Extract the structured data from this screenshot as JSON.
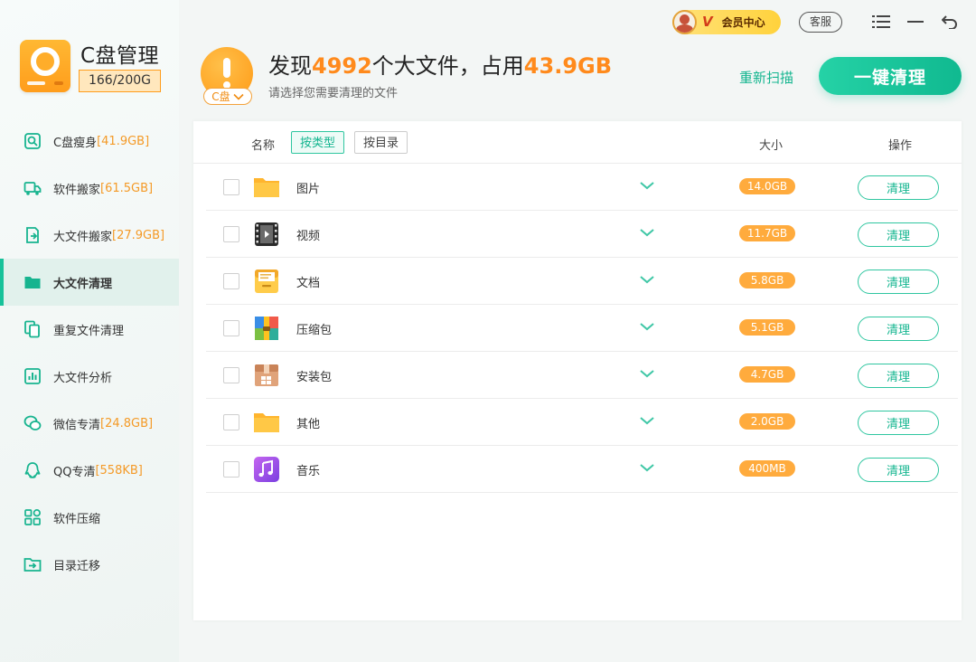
{
  "app": {
    "title": "C盘管理",
    "usage": "166/200G"
  },
  "topbar": {
    "vip_mark": "V",
    "vip_label": "会员中心",
    "service_label": "客服"
  },
  "sidebar": {
    "items": [
      {
        "label": "C盘瘦身",
        "size": "[41.9GB]",
        "icon": "disk-slim-icon"
      },
      {
        "label": "软件搬家",
        "size": "[61.5GB]",
        "icon": "truck-icon"
      },
      {
        "label": "大文件搬家",
        "size": "[27.9GB]",
        "icon": "file-move-icon"
      },
      {
        "label": "大文件清理",
        "size": "",
        "icon": "folder-icon",
        "active": true
      },
      {
        "label": "重复文件清理",
        "size": "",
        "icon": "duplicate-icon"
      },
      {
        "label": "大文件分析",
        "size": "",
        "icon": "chart-icon"
      },
      {
        "label": "微信专清",
        "size": "[24.8GB]",
        "icon": "wechat-icon"
      },
      {
        "label": "QQ专清",
        "size": "[558KB]",
        "icon": "qq-icon"
      },
      {
        "label": "软件压缩",
        "size": "",
        "icon": "grid-icon"
      },
      {
        "label": "目录迁移",
        "size": "",
        "icon": "folder-arrow-icon"
      }
    ]
  },
  "header": {
    "drive_label": "C盘",
    "prefix": "发现",
    "count": "4992",
    "middle": "个大文件，占用",
    "total": "43.9GB",
    "subtitle": "请选择您需要清理的文件",
    "rescan_label": "重新扫描",
    "clean_all_label": "一键清理"
  },
  "table": {
    "col_name": "名称",
    "filter_type": "按类型",
    "filter_dir": "按目录",
    "col_size": "大小",
    "col_action": "操作",
    "row_action_label": "清理",
    "rows": [
      {
        "name": "图片",
        "size": "14.0GB",
        "icon": "picture-folder-icon"
      },
      {
        "name": "视频",
        "size": "11.7GB",
        "icon": "video-icon"
      },
      {
        "name": "文档",
        "size": "5.8GB",
        "icon": "document-icon"
      },
      {
        "name": "压缩包",
        "size": "5.1GB",
        "icon": "archive-icon"
      },
      {
        "name": "安装包",
        "size": "4.7GB",
        "icon": "package-icon"
      },
      {
        "name": "其他",
        "size": "2.0GB",
        "icon": "other-folder-icon"
      },
      {
        "name": "音乐",
        "size": "400MB",
        "icon": "music-icon"
      }
    ]
  },
  "colors": {
    "accent": "#17c29a",
    "highlight": "#ff8a1c",
    "badge": "#ffab3d"
  }
}
